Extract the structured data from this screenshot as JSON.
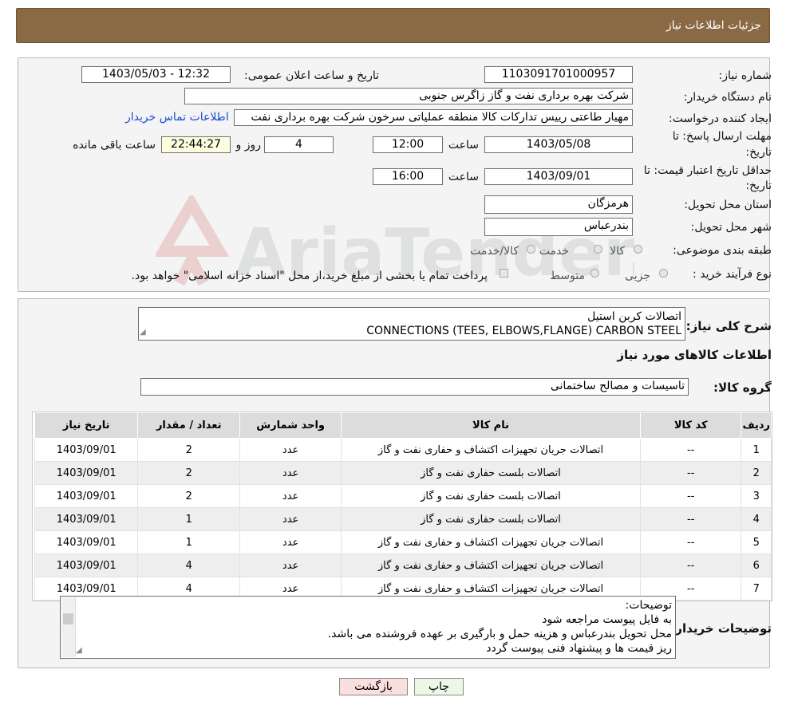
{
  "header": {
    "title": "جزئیات اطلاعات نیاز"
  },
  "need_number": {
    "label": "شماره نیاز:",
    "value": "1103091701000957"
  },
  "announce_datetime": {
    "label": "تاریخ و ساعت اعلان عمومی:",
    "value": "1403/05/03 - 12:32"
  },
  "buyer": {
    "label": "نام دستگاه خریدار:",
    "value": "شرکت بهره برداری نفت و گاز زاگرس جنوبی"
  },
  "creator": {
    "label": "ایجاد کننده درخواست:",
    "value": "مهیار  طاعتی رییس تداركات كالا منطقه عملياتی سرخون شرکت بهره برداری نفت",
    "contact_link": "اطلاعات تماس خریدار"
  },
  "deadline": {
    "label_line1": "مهلت ارسال پاسخ: تا",
    "label_line2": "تاریخ:",
    "date": "1403/05/08",
    "time_label": "ساعت",
    "time": "12:00",
    "days": "4",
    "days_label": "روز و",
    "remaining": "22:44:27",
    "remaining_label": "ساعت باقی مانده"
  },
  "validity": {
    "label_line1": "حداقل تاریخ اعتبار قیمت: تا",
    "label_line2": "تاریخ:",
    "date": "1403/09/01",
    "time_label": "ساعت",
    "time": "16:00"
  },
  "province": {
    "label": "استان محل تحویل:",
    "value": "هرمزگان"
  },
  "city": {
    "label": "شهر محل تحویل:",
    "value": "بندرعباس"
  },
  "category": {
    "label": "طبقه بندی موضوعی:",
    "options": [
      "کالا",
      "خدمت",
      "کالا/خدمت"
    ]
  },
  "process": {
    "label": "نوع فرآیند خرید :",
    "options": [
      "جزیی",
      "متوسط"
    ],
    "note": "پرداخت تمام یا بخشی از مبلغ خرید،از محل \"اسناد خزانه اسلامی\" خواهد بود."
  },
  "watermark": {
    "text": "AriaTender.neT"
  },
  "summary": {
    "label": "شرح کلی نیاز:",
    "line1": "اتصالات کربن استیل",
    "line2": "CONNECTIONS (TEES, ELBOWS,FLANGE) CARBON STEEL"
  },
  "goods_info": {
    "title": "اطلاعات کالاهای مورد نیاز"
  },
  "goods_group": {
    "label": "گروه کالا:",
    "value": "تاسیسات و مصالح ساختمانی"
  },
  "table": {
    "headers": [
      "ردیف",
      "کد کالا",
      "نام کالا",
      "واحد شمارش",
      "تعداد / مقدار",
      "تاریخ نیاز"
    ],
    "rows": [
      [
        "1",
        "--",
        "اتصالات جريان تجهيزات اكتشاف و حفاری نفت و گاز",
        "عدد",
        "2",
        "1403/09/01"
      ],
      [
        "2",
        "--",
        "اتصالات بلست حفاری نفت و گاز",
        "عدد",
        "2",
        "1403/09/01"
      ],
      [
        "3",
        "--",
        "اتصالات بلست حفاری نفت و گاز",
        "عدد",
        "2",
        "1403/09/01"
      ],
      [
        "4",
        "--",
        "اتصالات بلست حفاری نفت و گاز",
        "عدد",
        "1",
        "1403/09/01"
      ],
      [
        "5",
        "--",
        "اتصالات جريان تجهيزات اكتشاف و حفاری نفت و گاز",
        "عدد",
        "1",
        "1403/09/01"
      ],
      [
        "6",
        "--",
        "اتصالات جريان تجهيزات اكتشاف و حفاری نفت و گاز",
        "عدد",
        "4",
        "1403/09/01"
      ],
      [
        "7",
        "--",
        "اتصالات جريان تجهيزات اكتشاف و حفاری نفت و گاز",
        "عدد",
        "4",
        "1403/09/01"
      ]
    ]
  },
  "buyer_notes": {
    "label": "توضیحات خریدار:",
    "lines": [
      "توضیحات:",
      "به فایل پیوست مراجعه شود",
      "محل تحویل  بندرعباس و هزینه حمل و بارگیری  بر عهده فروشنده می باشد.",
      "ریز قیمت ها و پیشنهاد فنی پیوست گردد"
    ]
  },
  "buttons": {
    "print": "چاپ",
    "back": "بازگشت"
  }
}
